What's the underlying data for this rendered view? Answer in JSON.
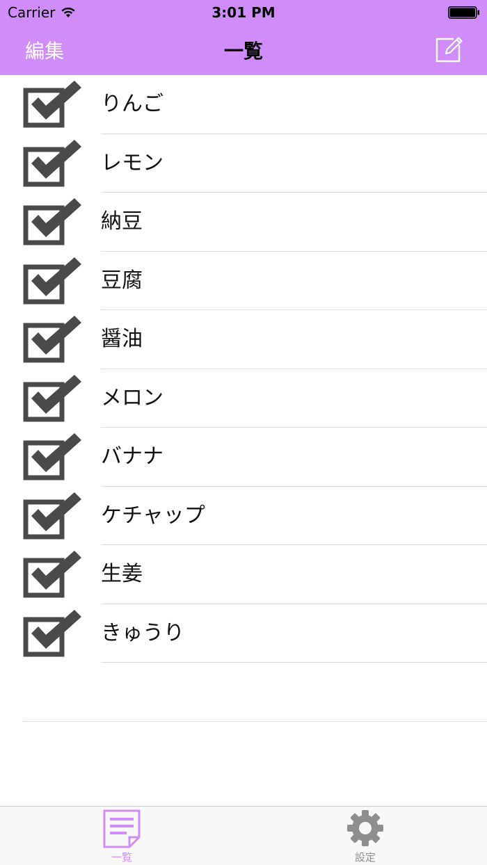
{
  "colors": {
    "accent": "#d08dfa",
    "checkbox": "#4a4a4a",
    "tab_inactive": "#8e8e8e"
  },
  "status_bar": {
    "carrier": "Carrier",
    "time": "3:01 PM",
    "icons": [
      "wifi-icon",
      "battery-icon"
    ]
  },
  "nav": {
    "edit_label": "編集",
    "title": "一覧",
    "compose_icon": "compose-icon"
  },
  "list": {
    "items": [
      {
        "label": "りんご",
        "checked": true
      },
      {
        "label": "レモン",
        "checked": true
      },
      {
        "label": "納豆",
        "checked": true
      },
      {
        "label": "豆腐",
        "checked": true
      },
      {
        "label": "醤油",
        "checked": true
      },
      {
        "label": "メロン",
        "checked": true
      },
      {
        "label": "バナナ",
        "checked": true
      },
      {
        "label": "ケチャップ",
        "checked": true
      },
      {
        "label": "生姜",
        "checked": true
      },
      {
        "label": "きゅうり",
        "checked": true
      }
    ]
  },
  "tabs": [
    {
      "label": "一覧",
      "icon": "list-document-icon",
      "selected": true
    },
    {
      "label": "設定",
      "icon": "gear-icon",
      "selected": false
    }
  ]
}
